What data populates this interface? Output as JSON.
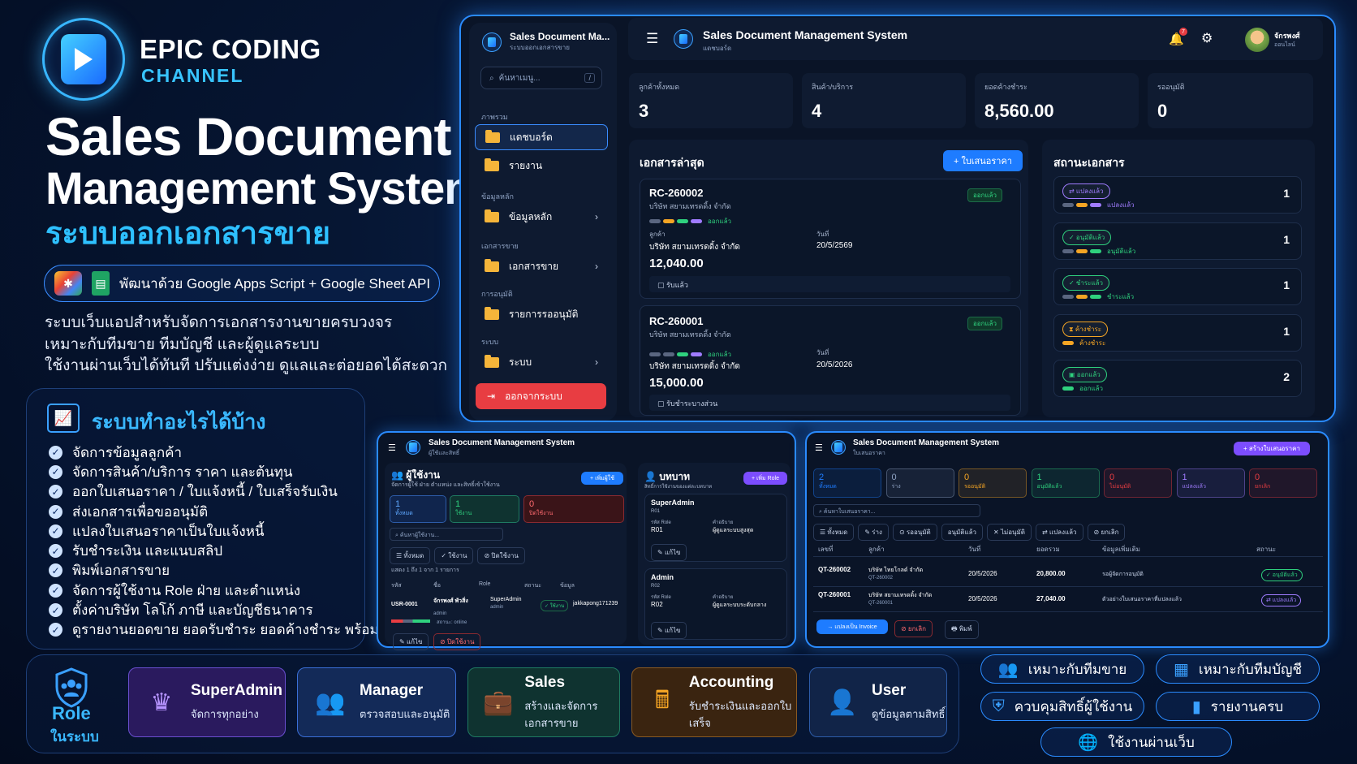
{
  "brand": {
    "line1": "EPIC CODING",
    "line2": "CHANNEL"
  },
  "hero": {
    "title1": "Sales Document",
    "title2": "Management System",
    "title_th": "ระบบออกเอกสารขาย",
    "tech": "พัฒนาด้วย Google Apps Script + Google Sheet API",
    "desc": [
      "ระบบเว็บแอปสำหรับจัดการเอกสารงานขายครบวงจร",
      "เหมาะกับทีมขาย ทีมบัญชี และผู้ดูแลระบบ",
      "ใช้งานผ่านเว็บได้ทันที ปรับแต่งง่าย ดูแลและต่อยอดได้สะดวก"
    ]
  },
  "features": {
    "title": "ระบบทำอะไรได้บ้าง",
    "items": [
      "จัดการข้อมูลลูกค้า",
      "จัดการสินค้า/บริการ ราคา และต้นทุน",
      "ออกใบเสนอราคา / ใบแจ้งหนี้ / ใบเสร็จรับเงิน",
      "ส่งเอกสารเพื่อขออนุมัติ",
      "แปลงใบเสนอราคาเป็นใบแจ้งหนี้",
      "รับชำระเงิน และแนบสลิป",
      "พิมพ์เอกสารขาย",
      "จัดการผู้ใช้งาน Role ฝ่าย และตำแหน่ง",
      "ตั้งค่าบริษัท โลโก้ ภาษี และบัญชีธนาคาร",
      "ดูรายงานยอดขาย ยอดรับชำระ ยอดค้างชำระ พร้อมกราฟ"
    ]
  },
  "dashboard": {
    "sidebar": {
      "title": "Sales Document Ma...",
      "subtitle": "ระบบออกเอกสารขาย",
      "search_placeholder": "ค้นหาเมนู...",
      "search_key": "/",
      "sec1": "ภาพรวม",
      "item_dashboard": "แดชบอร์ด",
      "item_report": "รายงาน",
      "sec2": "ข้อมูลหลัก",
      "item_master": "ข้อมูลหลัก",
      "sec3": "เอกสารขาย",
      "item_docs": "เอกสารขาย",
      "sec4": "การอนุมัติ",
      "item_approve": "รายการรออนุมัติ",
      "sec5": "ระบบ",
      "item_system": "ระบบ",
      "logout": "ออกจากระบบ"
    },
    "topbar": {
      "title": "Sales Document Management System",
      "subtitle": "แดชบอร์ด",
      "badge": "7",
      "user": "จักรพงศ์",
      "status": "ออนไลน์"
    },
    "stats": [
      {
        "label": "ลูกค้าทั้งหมด",
        "value": "3"
      },
      {
        "label": "สินค้า/บริการ",
        "value": "4"
      },
      {
        "label": "ยอดค้างชำระ",
        "value": "8,560.00"
      },
      {
        "label": "รออนุมัติ",
        "value": "0"
      }
    ],
    "recent": {
      "title": "เอกสารล่าสุด",
      "add_btn": "+ ใบเสนอราคา",
      "docs": [
        {
          "no": "RC-260002",
          "company": "บริษัท สยามเทรดดิ้ง จำกัด",
          "badge": "ออกแล้ว",
          "flow": "ออกแล้ว",
          "cust_label": "ลูกค้า",
          "cust": "บริษัท สยามเทรดดิ้ง จำกัด",
          "date_label": "วันที่",
          "date": "20/5/2569",
          "amount": "12,040.00",
          "note": "รับแล้ว"
        },
        {
          "no": "RC-260001",
          "company": "บริษัท สยามเทรดดิ้ง จำกัด",
          "badge": "ออกแล้ว",
          "flow": "ออกแล้ว",
          "cust_label": "",
          "cust": "บริษัท สยามเทรดดิ้ง จำกัด",
          "date_label": "วันที่",
          "date": "20/5/2026",
          "amount": "15,000.00",
          "note": "รับชำระบางส่วน"
        }
      ]
    },
    "status": {
      "title": "สถานะเอกสาร",
      "rows": [
        {
          "badge": "⇄ แปลงแล้ว",
          "sub": "แปลงแล้ว",
          "count": "1",
          "color": "#a07cff"
        },
        {
          "badge": "✓ อนุมัติแล้ว",
          "sub": "อนุมัติแล้ว",
          "count": "1",
          "color": "#2fd17e"
        },
        {
          "badge": "✓ ชำระแล้ว",
          "sub": "ชำระแล้ว",
          "count": "1",
          "color": "#2fd17e"
        },
        {
          "badge": "⧗ ค้างชำระ",
          "sub": "ค้างชำระ",
          "count": "1",
          "color": "#f5a524"
        },
        {
          "badge": "▣ ออกแล้ว",
          "sub": "ออกแล้ว",
          "count": "2",
          "color": "#2fd17e"
        }
      ]
    }
  },
  "users_screen": {
    "title": "Sales Document Management System",
    "subtitle": "ผู้ใช้และสิทธิ์",
    "users": {
      "title": "ผู้ใช้งาน",
      "desc": "จัดการผู้ใช้ ฝ่าย ตำแหน่ง และสิทธิ์เข้าใช้งาน",
      "add": "+ เพิ่มผู้ใช้",
      "boxes": [
        {
          "n": "1",
          "l": "ทั้งหมด"
        },
        {
          "n": "1",
          "l": "ใช้งาน"
        },
        {
          "n": "0",
          "l": "ปิดใช้งาน"
        }
      ],
      "search": "ค้นหาผู้ใช้งาน...",
      "filters": [
        "☰ ทั้งหมด",
        "✓ ใช้งาน",
        "⊘ ปิดใช้งาน"
      ],
      "showing": "แสดง 1 ถึง 1 จาก 1 รายการ",
      "cols": [
        "รหัส",
        "ชื่อ",
        "Role",
        "สถานะ",
        "ข้อมูล"
      ],
      "row": {
        "id": "USR-0001",
        "name": "จักรพงศ์ พัวสิ่ง",
        "role_sub": "admin",
        "role": "SuperAdmin",
        "role2": "admin",
        "status": "✓ ใช้งาน",
        "info": "jakkapong171239"
      },
      "online": "สถานะ: online",
      "edit": "แก้ไข",
      "disable": "ปิดใช้งาน"
    },
    "roles": {
      "title": "บทบาท",
      "desc": "สิทธิ์การใช้งานของแต่ละบทบาท",
      "add": "+ เพิ่ม Role",
      "cards": [
        {
          "name": "SuperAdmin",
          "code": "R01",
          "code_label": "รหัส Role",
          "code_v": "R01",
          "desc_label": "คำอธิบาย",
          "desc": "ผู้ดูแลระบบสูงสุด",
          "edit": "แก้ไข"
        },
        {
          "name": "Admin",
          "code": "R02",
          "code_label": "รหัส Role",
          "code_v": "R02",
          "desc_label": "คำอธิบาย",
          "desc": "ผู้ดูแลระบบระดับกลาง",
          "edit": "แก้ไข"
        }
      ]
    }
  },
  "quote_screen": {
    "title": "Sales Document Management System",
    "subtitle": "ใบเสนอราคา",
    "add": "+ สร้างใบเสนอราคา",
    "boxes": [
      {
        "n": "2",
        "l": "ทั้งหมด",
        "c": "#1e7cff"
      },
      {
        "n": "0",
        "l": "ร่าง",
        "c": "#8fa3c4"
      },
      {
        "n": "0",
        "l": "รออนุมัติ",
        "c": "#f5a524"
      },
      {
        "n": "1",
        "l": "อนุมัติแล้ว",
        "c": "#2fd17e"
      },
      {
        "n": "0",
        "l": "ไม่อนุมัติ",
        "c": "#e83d42"
      },
      {
        "n": "1",
        "l": "แปลงแล้ว",
        "c": "#a07cff"
      },
      {
        "n": "0",
        "l": "ยกเลิก",
        "c": "#e83d42"
      }
    ],
    "search": "ค้นหาใบเสนอราคา...",
    "filters": [
      "☰ ทั้งหมด",
      "✎ ร่าง",
      "⊙ รออนุมัติ",
      "อนุมัติแล้ว",
      "✕ ไม่อนุมัติ",
      "⇄ แปลงแล้ว",
      "⊘ ยกเลิก"
    ],
    "cols": [
      "เลขที่",
      "ลูกค้า",
      "วันที่",
      "ยอดรวม",
      "ข้อมูลเพิ่มเติม",
      "สถานะ"
    ],
    "rows": [
      {
        "no": "QT-260002",
        "sub": "QT-260002",
        "cust": "บริษัท ไทยโกลด์ จำกัด",
        "date": "20/5/2026",
        "total": "20,800.00",
        "info": "รอผู้จัดการอนุมัติ",
        "status": "✓ อนุมัติแล้ว",
        "sc": "#2fd17e"
      },
      {
        "no": "QT-260001",
        "sub": "QT-260001",
        "cust": "บริษัท สยามเทรดดิ้ง จำกัด",
        "date": "20/5/2026",
        "total": "27,040.00",
        "info": "ตัวอย่างใบเสนอราคาที่แปลงแล้ว",
        "status": "⇄ แปลงแล้ว",
        "sc": "#a07cff"
      }
    ],
    "actions": [
      "→ แปลงเป็น Invoice",
      "⊘ ยกเลิก",
      "🖶 พิมพ์"
    ]
  },
  "roles_bar": {
    "title": "Role",
    "subtitle": "ในระบบ",
    "cards": [
      {
        "name": "SuperAdmin",
        "desc": "จัดการทุกอย่าง",
        "icon": "♛",
        "bg": "#2a1a5e",
        "bd": "#6a4fd0",
        "ic": "#b794ff"
      },
      {
        "name": "Manager",
        "desc": "ตรวจสอบและอนุมัติ",
        "icon": "👥",
        "bg": "#132a58",
        "bd": "#3a6fd8",
        "ic": "#5fa8ff"
      },
      {
        "name": "Sales",
        "desc": "สร้างและจัดการเอกสารขาย",
        "icon": "💼",
        "bg": "#0f3330",
        "bd": "#1f7a62",
        "ic": "#2fd17e"
      },
      {
        "name": "Accounting",
        "desc": "รับชำระเงินและออกใบเสร็จ",
        "icon": "🖩",
        "bg": "#3a2410",
        "bd": "#8a5a22",
        "ic": "#f5a524"
      },
      {
        "name": "User",
        "desc": "ดูข้อมูลตามสิทธิ์",
        "icon": "👤",
        "bg": "#112448",
        "bd": "#2d5ca8",
        "ic": "#5fa8ff"
      }
    ]
  },
  "pills": [
    "เหมาะกับทีมขาย",
    "เหมาะกับทีมบัญชี",
    "ควบคุมสิทธิ์ผู้ใช้งาน",
    "รายงานครบ",
    "ใช้งานผ่านเว็บ"
  ]
}
